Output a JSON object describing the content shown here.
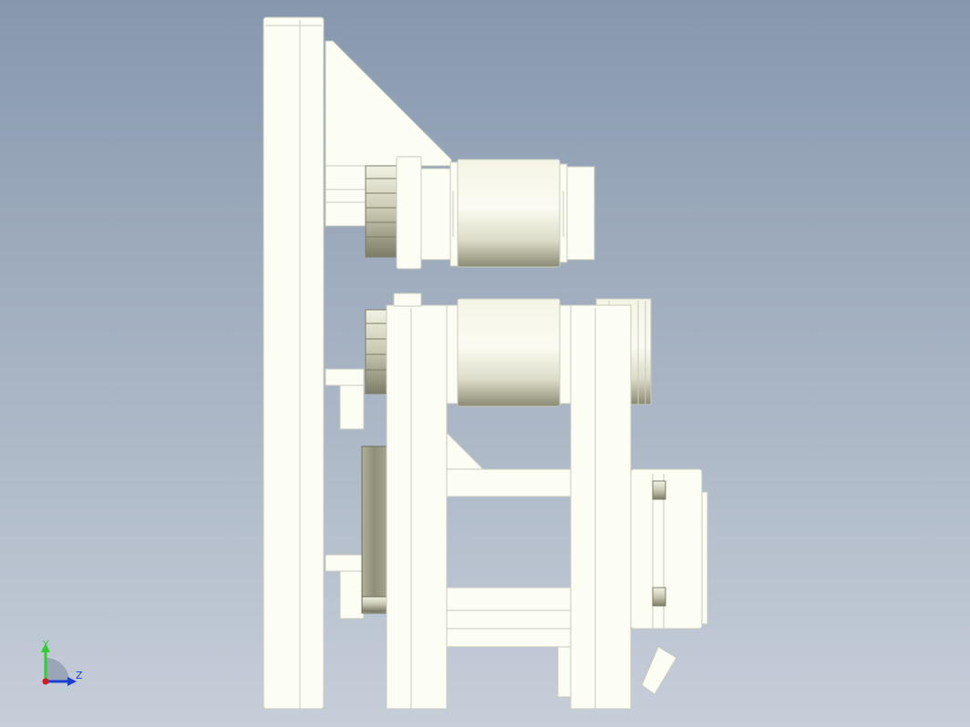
{
  "viewport": {
    "background_top": "#8798ae",
    "background_bottom": "#c6ced9",
    "part_fill": "#fcfef4",
    "part_stroke": "#c9cbbf",
    "shade_dark": "#8e8e7a"
  },
  "triad": {
    "y_label": "Y",
    "z_label": "Z",
    "y_color": "#2fcf2f",
    "z_color": "#1a3fd6",
    "x_color": "#d61a1a"
  }
}
